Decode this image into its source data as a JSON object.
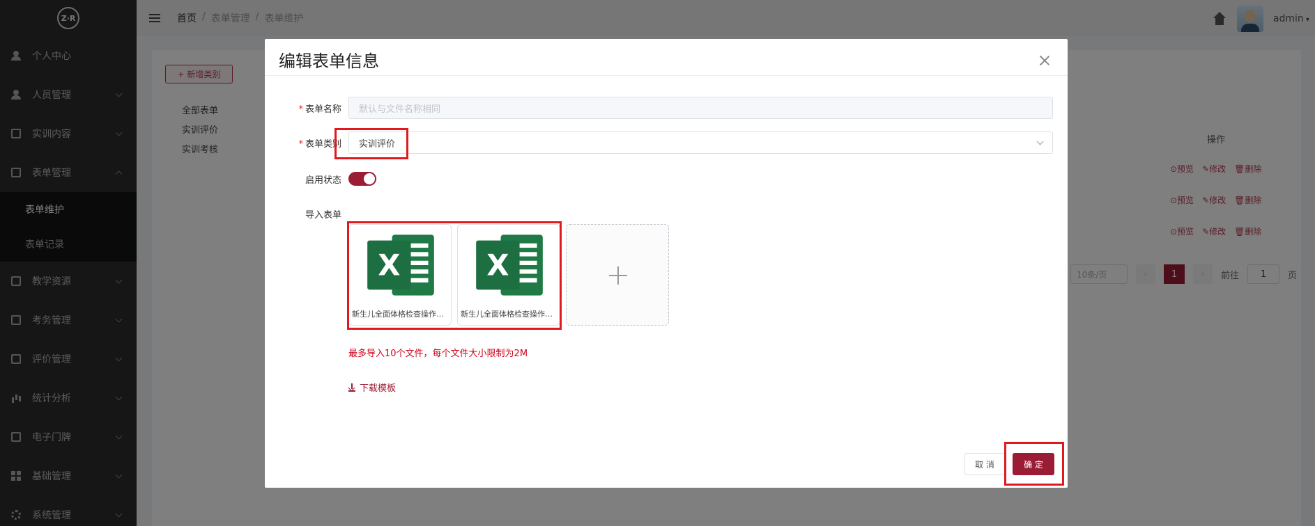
{
  "app": {
    "logo_text": "Z·R",
    "user_name": "admin"
  },
  "sidebar": {
    "items": [
      {
        "label": "个人中心",
        "icon": "user-icon"
      },
      {
        "label": "人员管理",
        "icon": "users-icon"
      },
      {
        "label": "实训内容",
        "icon": "content-icon"
      },
      {
        "label": "表单管理",
        "icon": "form-icon",
        "expanded": true
      },
      {
        "label": "教学资源",
        "icon": "resource-icon"
      },
      {
        "label": "考务管理",
        "icon": "exam-icon"
      },
      {
        "label": "评价管理",
        "icon": "evaluation-icon"
      },
      {
        "label": "统计分析",
        "icon": "chart-icon"
      },
      {
        "label": "电子门牌",
        "icon": "doorplate-icon"
      },
      {
        "label": "基础管理",
        "icon": "grid-icon"
      },
      {
        "label": "系统管理",
        "icon": "gear-icon"
      }
    ],
    "submenu": [
      {
        "label": "表单维护",
        "active": true
      },
      {
        "label": "表单记录",
        "active": false
      }
    ]
  },
  "breadcrumb": [
    "首页",
    "/",
    "表单管理",
    "/",
    "表单维护"
  ],
  "background": {
    "add_category_label": "+ 新增类别",
    "categories": [
      "全部表单",
      "实训评价",
      "实训考核"
    ],
    "op_header": "操作",
    "row_actions": [
      "⊙预览",
      "✎修改",
      "🗑删除"
    ],
    "pager": {
      "page_size": "10条/页",
      "current_page": "1",
      "goto_label": "前往",
      "goto_value": "1",
      "page_unit": "页"
    }
  },
  "modal": {
    "title": "编辑表单信息",
    "fields": {
      "name_label": "表单名称",
      "name_placeholder": "默认与文件名称相同",
      "category_label": "表单类别",
      "category_value": "实训评价",
      "status_label": "启用状态",
      "status_enabled": true,
      "import_label": "导入表单"
    },
    "files": [
      {
        "name": "新生儿全面体格检查操作评分表.xlsx",
        "icon": "excel-icon"
      },
      {
        "name": "新生儿全面体格检查操作评分表.xlsx",
        "icon": "excel-icon"
      }
    ],
    "hint": "最多导入10个文件，每个文件大小限制为2M",
    "download_label": "下载模板",
    "cancel_label": "取 消",
    "confirm_label": "确 定"
  },
  "colors": {
    "accent": "#9b1d35",
    "sidebar_bg": "#2c2c2c",
    "highlight": "#e0191f",
    "excel_green": "#1d6f42"
  }
}
